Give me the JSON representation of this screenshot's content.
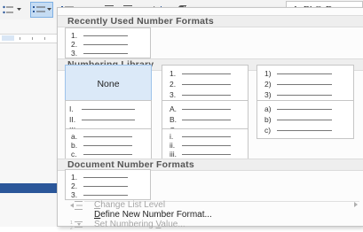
{
  "ribbon": {
    "style_preview": "AaBbCcDc"
  },
  "dropdown": {
    "sections": {
      "recent": "Recently Used Number Formats",
      "library": "Numbering Library",
      "document": "Document Number Formats"
    },
    "recent_tile": [
      "1.",
      "2.",
      "3."
    ],
    "none_label": "None",
    "library_tiles": [
      [
        "1.",
        "2.",
        "3."
      ],
      [
        "1)",
        "2)",
        "3)"
      ],
      [
        "I.",
        "II.",
        "III."
      ],
      [
        "A.",
        "B.",
        "C."
      ],
      [
        "a)",
        "b)",
        "c)"
      ],
      [
        "a.",
        "b.",
        "c."
      ],
      [
        "i.",
        "ii.",
        "iii."
      ]
    ],
    "document_tile": [
      "1.",
      "2.",
      "3."
    ],
    "menu": {
      "change_list_level": {
        "first": "C",
        "rest": "hange List Level"
      },
      "define_new": {
        "first": "D",
        "rest": "efine New Number Format..."
      },
      "set_numbering": {
        "pre": "Set Numbering ",
        "key": "V",
        "rest": "alue..."
      }
    }
  }
}
